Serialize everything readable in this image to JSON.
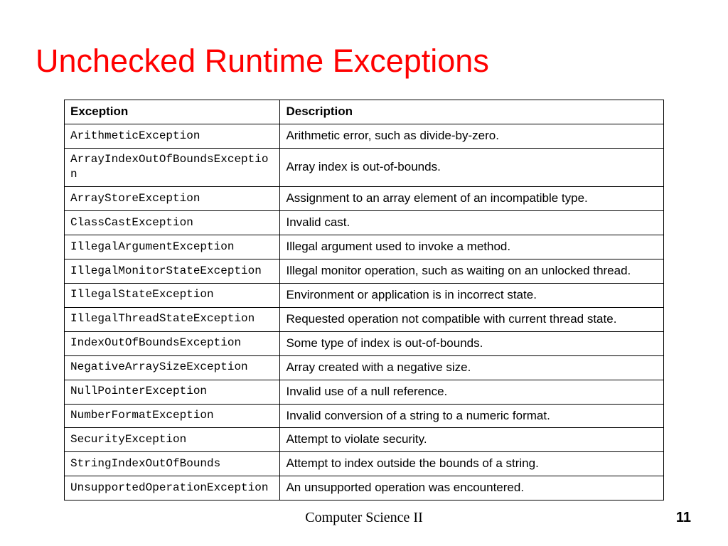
{
  "title": "Unchecked Runtime Exceptions",
  "columns": {
    "exception": "Exception",
    "description": "Description"
  },
  "rows": [
    {
      "exception": "ArithmeticException",
      "description": "Arithmetic error, such as divide-by-zero."
    },
    {
      "exception": "ArrayIndexOutOfBoundsException",
      "description": "Array index is out-of-bounds."
    },
    {
      "exception": "ArrayStoreException",
      "description": "Assignment to an array element of an incompatible type."
    },
    {
      "exception": "ClassCastException",
      "description": "Invalid cast."
    },
    {
      "exception": "IllegalArgumentException",
      "description": "Illegal argument used to invoke a method."
    },
    {
      "exception": "IllegalMonitorStateException",
      "description": "Illegal monitor operation, such as waiting on an unlocked thread."
    },
    {
      "exception": "IllegalStateException",
      "description": "Environment or application is in incorrect state."
    },
    {
      "exception": "IllegalThreadStateException",
      "description": "Requested operation not compatible with current thread state."
    },
    {
      "exception": "IndexOutOfBoundsException",
      "description": "Some type of index is out-of-bounds."
    },
    {
      "exception": "NegativeArraySizeException",
      "description": "Array created with a negative size."
    },
    {
      "exception": "NullPointerException",
      "description": "Invalid use of a null reference."
    },
    {
      "exception": "NumberFormatException",
      "description": "Invalid conversion of a string to a numeric format."
    },
    {
      "exception": "SecurityException",
      "description": "Attempt to violate security."
    },
    {
      "exception": "StringIndexOutOfBounds",
      "description": "Attempt to index outside the bounds of a string."
    },
    {
      "exception": "UnsupportedOperationException",
      "description": "An unsupported operation was encountered."
    }
  ],
  "footer": {
    "course": "Computer Science II",
    "page": "11"
  }
}
